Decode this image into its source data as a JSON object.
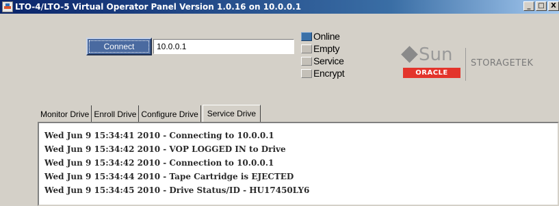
{
  "window": {
    "title": "LTO-4/LTO-5 Virtual Operator Panel Version 1.0.16 on 10.0.0.1",
    "controls": [
      "_",
      "□",
      "X"
    ]
  },
  "connection": {
    "connect_label": "Connect",
    "host_value": "10.0.0.1"
  },
  "status": [
    {
      "label": "Online",
      "active": true
    },
    {
      "label": "Empty",
      "active": false
    },
    {
      "label": "Service",
      "active": false
    },
    {
      "label": "Encrypt",
      "active": false
    }
  ],
  "branding": {
    "sun": "Sun",
    "oracle": "ORACLE",
    "storagetek": "STORAGETEK"
  },
  "tabs": [
    {
      "label": "Monitor Drive",
      "active": false
    },
    {
      "label": "Enroll Drive",
      "active": false
    },
    {
      "label": "Configure Drive",
      "active": false
    },
    {
      "label": "Service Drive",
      "active": true
    }
  ],
  "log": [
    "Wed Jun 9 15:34:41 2010 - Connecting to 10.0.0.1",
    "Wed Jun 9 15:34:42 2010 - VOP LOGGED IN to Drive",
    "Wed Jun 9 15:34:42 2010 - Connection to 10.0.0.1",
    "Wed Jun 9 15:34:44 2010 - Tape Cartridge is EJECTED",
    "Wed Jun 9 15:34:45 2010 - Drive Status/ID - HU17450LY6"
  ],
  "colors": {
    "titlebar": "#0a246a",
    "led_on": "#3a70a8",
    "oracle_red": "#e3342b"
  }
}
